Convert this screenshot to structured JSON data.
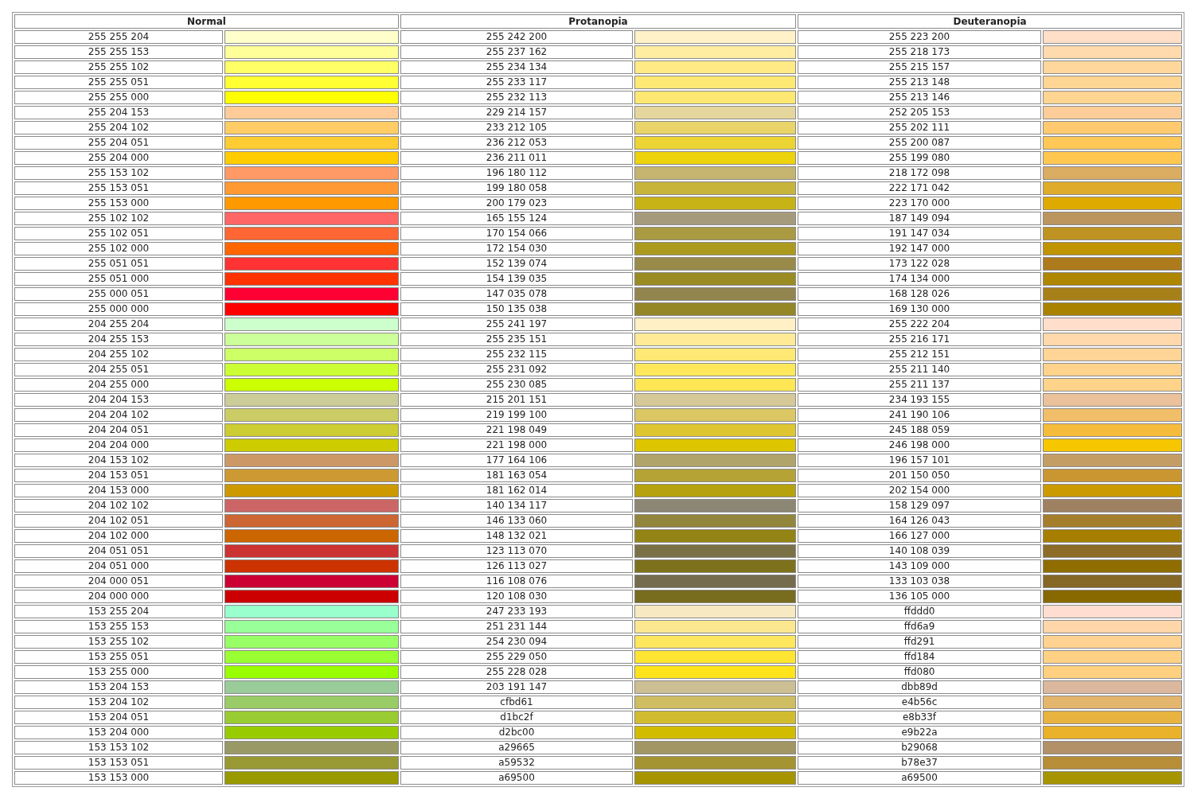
{
  "columns": [
    "Normal",
    "Protanopia",
    "Deuteranopia"
  ],
  "rows": [
    [
      {
        "label": "255 255 204",
        "color": "#ffffcc"
      },
      {
        "label": "255 242 200",
        "color": "#fff2c8"
      },
      {
        "label": "255 223 200",
        "color": "#ffdfc8"
      }
    ],
    [
      {
        "label": "255 255 153",
        "color": "#ffff99"
      },
      {
        "label": "255 237 162",
        "color": "#ffeda2"
      },
      {
        "label": "255 218 173",
        "color": "#ffdaad"
      }
    ],
    [
      {
        "label": "255 255 102",
        "color": "#ffff66"
      },
      {
        "label": "255 234 134",
        "color": "#ffea86"
      },
      {
        "label": "255 215 157",
        "color": "#ffd79d"
      }
    ],
    [
      {
        "label": "255 255 051",
        "color": "#ffff33"
      },
      {
        "label": "255 233 117",
        "color": "#ffe975"
      },
      {
        "label": "255 213 148",
        "color": "#ffd594"
      }
    ],
    [
      {
        "label": "255 255 000",
        "color": "#ffff00"
      },
      {
        "label": "255 232 113",
        "color": "#ffe871"
      },
      {
        "label": "255 213 146",
        "color": "#ffd592"
      }
    ],
    [
      {
        "label": "255 204 153",
        "color": "#ffcc99"
      },
      {
        "label": "229 214 157",
        "color": "#e5d69d"
      },
      {
        "label": "252 205 153",
        "color": "#fccd99"
      }
    ],
    [
      {
        "label": "255 204 102",
        "color": "#ffcc66"
      },
      {
        "label": "233 212 105",
        "color": "#e9d469"
      },
      {
        "label": "255 202 111",
        "color": "#ffca6f"
      }
    ],
    [
      {
        "label": "255 204 051",
        "color": "#ffcc33"
      },
      {
        "label": "236 212 053",
        "color": "#ecd435"
      },
      {
        "label": "255 200 087",
        "color": "#ffc857"
      }
    ],
    [
      {
        "label": "255 204 000",
        "color": "#ffcc00"
      },
      {
        "label": "236 211 011",
        "color": "#ecd30b"
      },
      {
        "label": "255 199 080",
        "color": "#ffc750"
      }
    ],
    [
      {
        "label": "255 153 102",
        "color": "#ff9966"
      },
      {
        "label": "196 180 112",
        "color": "#c4b470"
      },
      {
        "label": "218 172 098",
        "color": "#daac62"
      }
    ],
    [
      {
        "label": "255 153 051",
        "color": "#ff9933"
      },
      {
        "label": "199 180 058",
        "color": "#c7b43a"
      },
      {
        "label": "222 171 042",
        "color": "#deab2a"
      }
    ],
    [
      {
        "label": "255 153 000",
        "color": "#ff9900"
      },
      {
        "label": "200 179 023",
        "color": "#c8b317"
      },
      {
        "label": "223 170 000",
        "color": "#dfaa00"
      }
    ],
    [
      {
        "label": "255 102 102",
        "color": "#ff6666"
      },
      {
        "label": "165 155 124",
        "color": "#a59b7c"
      },
      {
        "label": "187 149 094",
        "color": "#bb955e"
      }
    ],
    [
      {
        "label": "255 102 051",
        "color": "#ff6633"
      },
      {
        "label": "170 154 066",
        "color": "#aa9a42"
      },
      {
        "label": "191 147 034",
        "color": "#bf9322"
      }
    ],
    [
      {
        "label": "255 102 000",
        "color": "#ff6600"
      },
      {
        "label": "172 154 030",
        "color": "#ac9a1e"
      },
      {
        "label": "192 147 000",
        "color": "#c09300"
      }
    ],
    [
      {
        "label": "255 051 051",
        "color": "#ff3333"
      },
      {
        "label": "152 139 074",
        "color": "#988b4a"
      },
      {
        "label": "173 122 028",
        "color": "#ad7a1c"
      }
    ],
    [
      {
        "label": "255 051 000",
        "color": "#ff3300"
      },
      {
        "label": "154 139 035",
        "color": "#9a8b23"
      },
      {
        "label": "174 134 000",
        "color": "#ae8600"
      }
    ],
    [
      {
        "label": "255 000 051",
        "color": "#ff0033"
      },
      {
        "label": "147 035 078",
        "color": "#93854e"
      },
      {
        "label": "168 128 026",
        "color": "#a8801a"
      }
    ],
    [
      {
        "label": "255 000 000",
        "color": "#ff0000"
      },
      {
        "label": "150 135 038",
        "color": "#968726"
      },
      {
        "label": "169 130 000",
        "color": "#a98200"
      }
    ],
    [
      {
        "label": "204 255 204",
        "color": "#ccffcc"
      },
      {
        "label": "255 241 197",
        "color": "#fff1c5"
      },
      {
        "label": "255 222 204",
        "color": "#ffdecc"
      }
    ],
    [
      {
        "label": "204 255 153",
        "color": "#ccff99"
      },
      {
        "label": "255 235 151",
        "color": "#ffeb97"
      },
      {
        "label": "255 216 171",
        "color": "#ffd8ab"
      }
    ],
    [
      {
        "label": "204 255 102",
        "color": "#ccff66"
      },
      {
        "label": "255 232 115",
        "color": "#ffe873"
      },
      {
        "label": "255 212 151",
        "color": "#ffd497"
      }
    ],
    [
      {
        "label": "204 255 051",
        "color": "#ccff33"
      },
      {
        "label": "255 231 092",
        "color": "#ffe75c"
      },
      {
        "label": "255 211 140",
        "color": "#ffd38c"
      }
    ],
    [
      {
        "label": "204 255 000",
        "color": "#ccff00"
      },
      {
        "label": "255 230 085",
        "color": "#ffe655"
      },
      {
        "label": "255 211 137",
        "color": "#ffd389"
      }
    ],
    [
      {
        "label": "204 204 153",
        "color": "#cccc99"
      },
      {
        "label": "215 201 151",
        "color": "#d7c997"
      },
      {
        "label": "234 193 155",
        "color": "#eac19b"
      }
    ],
    [
      {
        "label": "204 204 102",
        "color": "#cccc66"
      },
      {
        "label": "219 199 100",
        "color": "#dbc764"
      },
      {
        "label": "241 190 106",
        "color": "#f1be6a"
      }
    ],
    [
      {
        "label": "204 204 051",
        "color": "#cccc33"
      },
      {
        "label": "221 198 049",
        "color": "#ddc631"
      },
      {
        "label": "245 188 059",
        "color": "#f5bc3b"
      }
    ],
    [
      {
        "label": "204 204 000",
        "color": "#cccc00"
      },
      {
        "label": "221 198 000",
        "color": "#ddc600"
      },
      {
        "label": "246 198 000",
        "color": "#f6c600"
      }
    ],
    [
      {
        "label": "204 153 102",
        "color": "#cc9966"
      },
      {
        "label": "177 164 106",
        "color": "#b1a46a"
      },
      {
        "label": "196 157 101",
        "color": "#c49d65"
      }
    ],
    [
      {
        "label": "204 153 051",
        "color": "#cc9933"
      },
      {
        "label": "181 163 054",
        "color": "#b5a336"
      },
      {
        "label": "201 150 050",
        "color": "#c99632"
      }
    ],
    [
      {
        "label": "204 153 000",
        "color": "#cc9900"
      },
      {
        "label": "181 162 014",
        "color": "#b5a20e"
      },
      {
        "label": "202 154 000",
        "color": "#ca9a00"
      }
    ],
    [
      {
        "label": "204 102 102",
        "color": "#cc6666"
      },
      {
        "label": "140 134 117",
        "color": "#8c8675"
      },
      {
        "label": "158 129 097",
        "color": "#9e8161"
      }
    ],
    [
      {
        "label": "204 102 051",
        "color": "#cc6633"
      },
      {
        "label": "146 133 060",
        "color": "#92853c"
      },
      {
        "label": "164 126 043",
        "color": "#a47e2b"
      }
    ],
    [
      {
        "label": "204 102 000",
        "color": "#cc6600"
      },
      {
        "label": "148 132 021",
        "color": "#948415"
      },
      {
        "label": "166 127 000",
        "color": "#a67f00"
      }
    ],
    [
      {
        "label": "204 051 051",
        "color": "#cc3333"
      },
      {
        "label": "123 113 070",
        "color": "#7b7146"
      },
      {
        "label": "140 108 039",
        "color": "#8c6c27"
      }
    ],
    [
      {
        "label": "204 051 000",
        "color": "#cc3300"
      },
      {
        "label": "126 113 027",
        "color": "#7e711b"
      },
      {
        "label": "143 109 000",
        "color": "#8f6d00"
      }
    ],
    [
      {
        "label": "204 000 051",
        "color": "#cc0033"
      },
      {
        "label": "116 108 076",
        "color": "#746c4c"
      },
      {
        "label": "133 103 038",
        "color": "#856726"
      }
    ],
    [
      {
        "label": "204 000 000",
        "color": "#cc0000"
      },
      {
        "label": "120 108 030",
        "color": "#786c1e"
      },
      {
        "label": "136 105 000",
        "color": "#886900"
      }
    ],
    [
      {
        "label": "153 255 204",
        "color": "#99ffcc"
      },
      {
        "label": "247 233 193",
        "color": "#f7e9c1"
      },
      {
        "label": "ffddd0",
        "color": "#ffddd0"
      }
    ],
    [
      {
        "label": "153 255 153",
        "color": "#99ff99"
      },
      {
        "label": "251 231 144",
        "color": "#fbe790"
      },
      {
        "label": "ffd6a9",
        "color": "#ffd6a9"
      }
    ],
    [
      {
        "label": "153 255 102",
        "color": "#99ff66"
      },
      {
        "label": "254 230 094",
        "color": "#fee65e"
      },
      {
        "label": "ffd291",
        "color": "#ffd291"
      }
    ],
    [
      {
        "label": "153 255 051",
        "color": "#99ff33"
      },
      {
        "label": "255 229 050",
        "color": "#ffe532"
      },
      {
        "label": "ffd184",
        "color": "#ffd184"
      }
    ],
    [
      {
        "label": "153 255 000",
        "color": "#99ff00"
      },
      {
        "label": "255 228 028",
        "color": "#ffe41c"
      },
      {
        "label": "ffd080",
        "color": "#ffd080"
      }
    ],
    [
      {
        "label": "153 204 153",
        "color": "#99cc99"
      },
      {
        "label": "203 191 147",
        "color": "#cbbf93"
      },
      {
        "label": "dbb89d",
        "color": "#dbb89d"
      }
    ],
    [
      {
        "label": "153 204 102",
        "color": "#99cc66"
      },
      {
        "label": "cfbd61",
        "color": "#cfbd61"
      },
      {
        "label": "e4b56c",
        "color": "#e4b56c"
      }
    ],
    [
      {
        "label": "153 204 051",
        "color": "#99cc33"
      },
      {
        "label": "d1bc2f",
        "color": "#d1bc2f"
      },
      {
        "label": "e8b33f",
        "color": "#e8b33f"
      }
    ],
    [
      {
        "label": "153 204 000",
        "color": "#99cc00"
      },
      {
        "label": "d2bc00",
        "color": "#d2bc00"
      },
      {
        "label": "e9b22a",
        "color": "#e9b22a"
      }
    ],
    [
      {
        "label": "153 153 102",
        "color": "#999966"
      },
      {
        "label": "a29665",
        "color": "#a29665"
      },
      {
        "label": "b29068",
        "color": "#b29068"
      }
    ],
    [
      {
        "label": "153 153 051",
        "color": "#999933"
      },
      {
        "label": "a59532",
        "color": "#a59532"
      },
      {
        "label": "b78e37",
        "color": "#b78e37"
      }
    ],
    [
      {
        "label": "153 153 000",
        "color": "#999900"
      },
      {
        "label": "a69500",
        "color": "#a69500"
      },
      {
        "label": "a69500",
        "color": "#a69500"
      }
    ]
  ]
}
